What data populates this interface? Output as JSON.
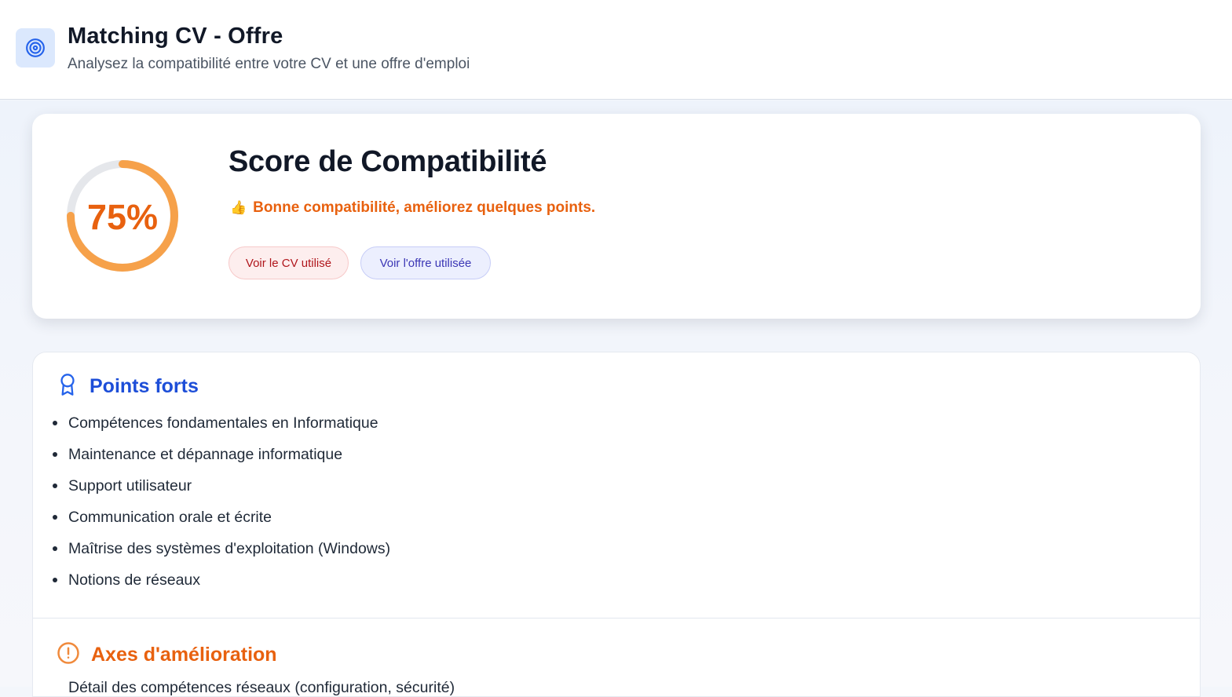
{
  "header": {
    "title": "Matching CV - Offre",
    "subtitle": "Analysez la compatibilité entre votre CV et une offre d'emploi",
    "icon": "target-icon"
  },
  "score": {
    "value_label": "75%",
    "value": 75,
    "title": "Score de Compatibilité",
    "message_icon": "👍",
    "message": "Bonne compatibilité, améliorez quelques points.",
    "accent_color": "#e8610f",
    "ring_color": "#f6a14a",
    "track_color": "#e5e7eb",
    "buttons": {
      "cv": "Voir le CV utilisé",
      "offer": "Voir l'offre utilisée"
    }
  },
  "strengths": {
    "title": "Points forts",
    "icon": "award-ribbon-icon",
    "color": "#1d4ed8",
    "items": [
      "Compétences fondamentales en Informatique",
      "Maintenance et dépannage informatique",
      "Support utilisateur",
      "Communication orale et écrite",
      "Maîtrise des systèmes d'exploitation (Windows)",
      "Notions de réseaux"
    ]
  },
  "improvements": {
    "title": "Axes d'amélioration",
    "icon": "alert-circle-icon",
    "color": "#e8610f",
    "items": [
      "Détail des compétences réseaux (configuration, sécurité)"
    ]
  }
}
